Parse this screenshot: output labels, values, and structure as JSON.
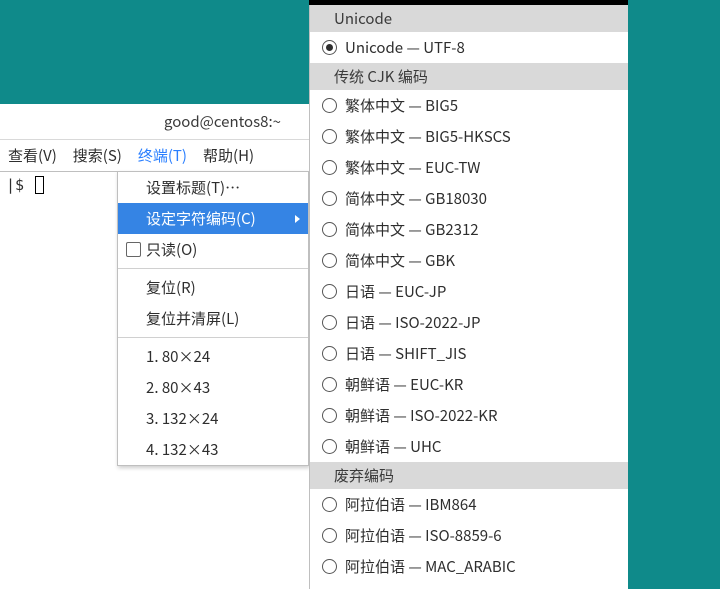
{
  "window": {
    "title": "good@centos8:~",
    "prompt": "|$"
  },
  "menubar": {
    "items": [
      {
        "label": "查看(V)"
      },
      {
        "label": "搜索(S)"
      },
      {
        "label": "终端(T)",
        "active": true
      },
      {
        "label": "帮助(H)"
      }
    ]
  },
  "dropdown": {
    "set_title": "设置标题(T)…",
    "set_encoding": "设定字符编码(C)",
    "readonly": "只读(O)",
    "reset": "复位(R)",
    "reset_clear": "复位并清屏(L)",
    "size1": "1. 80×24",
    "size2": "2. 80×43",
    "size3": "3. 132×24",
    "size4": "4. 132×43"
  },
  "encoding_menu": {
    "groups": [
      {
        "header": "Unicode",
        "items": [
          {
            "label": "Unicode — UTF-8",
            "selected": true
          }
        ]
      },
      {
        "header": "传统 CJK 编码",
        "items": [
          {
            "label": "繁体中文 — BIG5"
          },
          {
            "label": "繁体中文 — BIG5-HKSCS"
          },
          {
            "label": "繁体中文 — EUC-TW"
          },
          {
            "label": "简体中文 — GB18030"
          },
          {
            "label": "简体中文 — GB2312"
          },
          {
            "label": "简体中文 — GBK"
          },
          {
            "label": "日语 — EUC-JP"
          },
          {
            "label": "日语 — ISO-2022-JP"
          },
          {
            "label": "日语 — SHIFT_JIS"
          },
          {
            "label": "朝鲜语 — EUC-KR"
          },
          {
            "label": "朝鲜语 — ISO-2022-KR"
          },
          {
            "label": "朝鲜语 — UHC"
          }
        ]
      },
      {
        "header": "废弃编码",
        "items": [
          {
            "label": "阿拉伯语 — IBM864"
          },
          {
            "label": "阿拉伯语 — ISO-8859-6"
          },
          {
            "label": "阿拉伯语 — MAC_ARABIC"
          }
        ]
      }
    ]
  }
}
